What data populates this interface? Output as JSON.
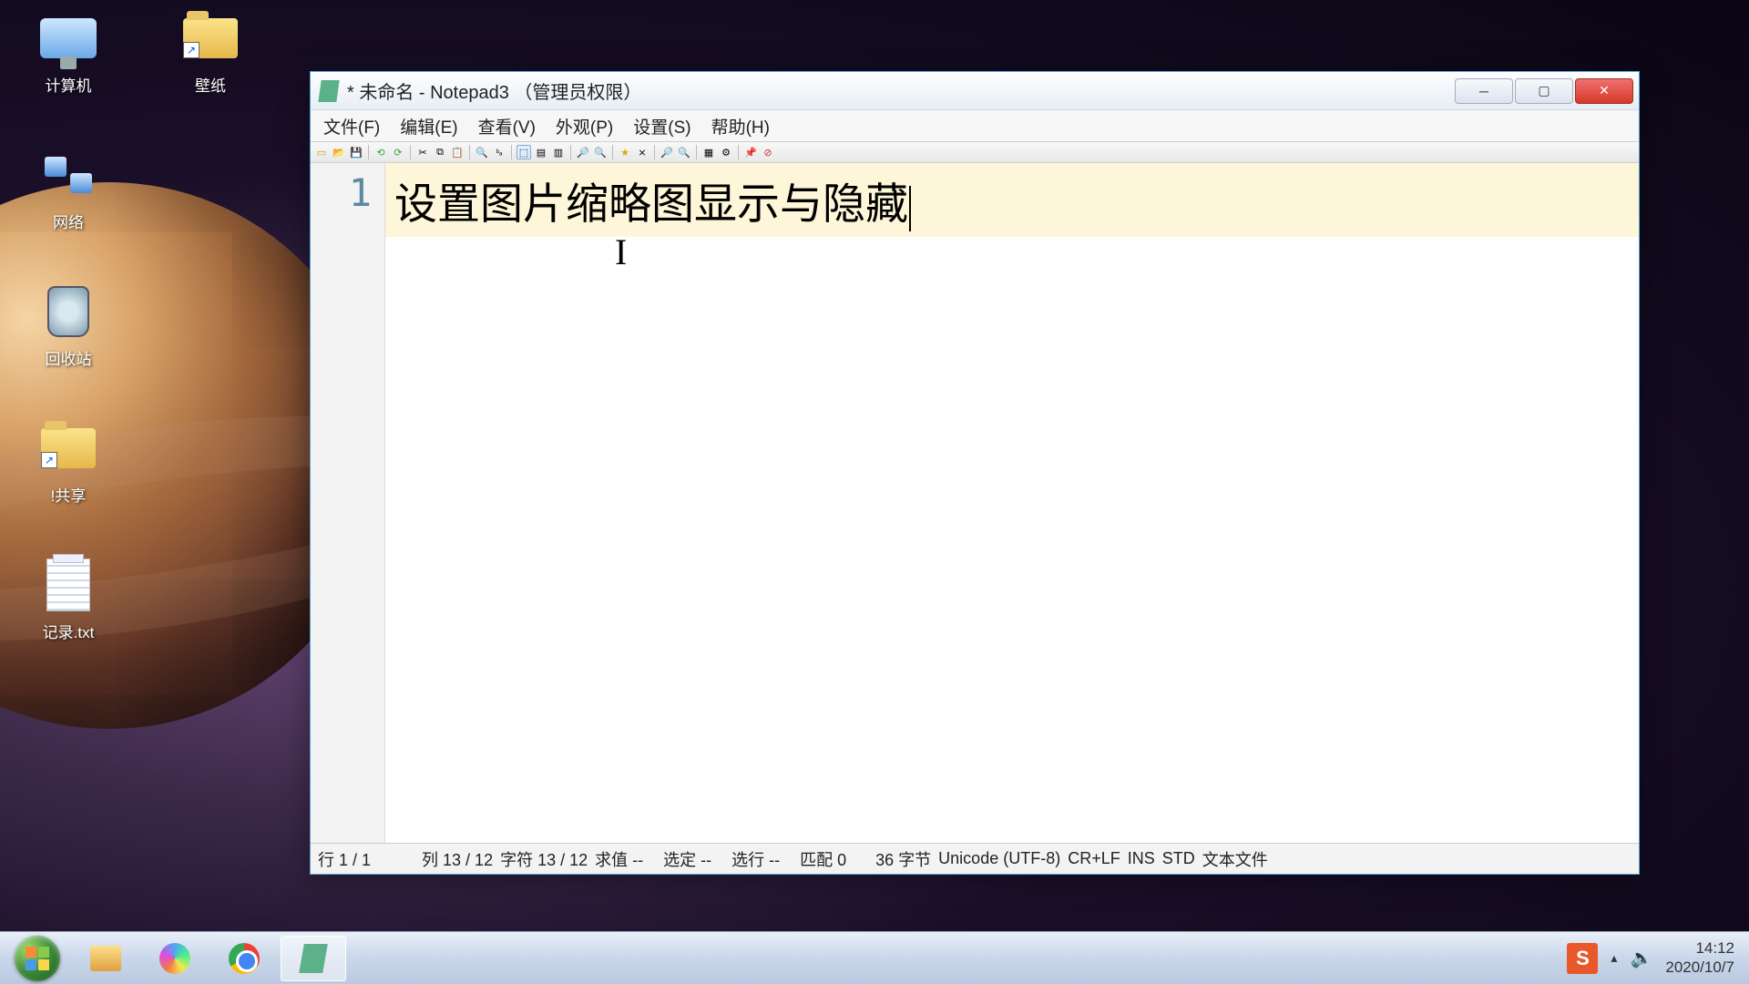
{
  "desktop_icons": {
    "computer": "计算机",
    "wallpaper": "壁纸",
    "network": "网络",
    "recycle": "回收站",
    "share": "!共享",
    "notes": "记录.txt"
  },
  "window": {
    "title": " * 未命名 - Notepad3 （管理员权限）",
    "menu": {
      "file": "文件(F)",
      "edit": "编辑(E)",
      "view": "查看(V)",
      "appearance": "外观(P)",
      "settings": "设置(S)",
      "help": "帮助(H)"
    },
    "editor": {
      "line_number": "1",
      "content": "设置图片缩略图显示与隐藏"
    },
    "statusbar": {
      "line": "行  1 / 1",
      "col": "列  13 / 12",
      "char": "字符  13 / 12",
      "eval": "求值  --",
      "sel": "选定  --",
      "sellines": "选行  --",
      "match": "匹配  0",
      "bytes": "36 字节",
      "encoding": "Unicode (UTF-8)",
      "eol": "CR+LF",
      "ins": "INS",
      "std": "STD",
      "type": "文本文件"
    }
  },
  "taskbar": {
    "ime": "S",
    "time": "14:12",
    "date": "2020/10/7"
  }
}
